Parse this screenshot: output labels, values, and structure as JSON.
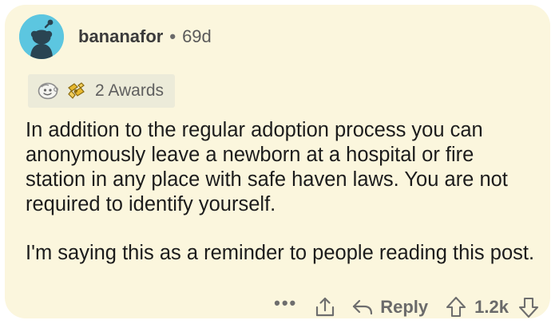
{
  "comment": {
    "username": "bananafor",
    "separator": "•",
    "age": "69d",
    "awards_label": "2 Awards",
    "paragraphs": [
      "In addition to the regular adoption process you can anonymously leave a newborn at a hospital or fire station in any place with safe haven laws. You are not required to identify yourself.",
      "I'm saying this as a reminder to people reading this post."
    ]
  },
  "actions": {
    "more_label": "•••",
    "reply_label": "Reply",
    "score": "1.2k"
  },
  "colors": {
    "card_background": "#fbf6dd",
    "avatar_background": "#5cc6e0",
    "awards_background": "#ecebd9",
    "text": "#1c1c1c",
    "muted": "#6a6a6a"
  },
  "icons": [
    "snoo-avatar",
    "wholesome-award-icon",
    "helpful-award-icon",
    "share-icon",
    "reply-arrow-icon",
    "upvote-icon",
    "downvote-icon"
  ]
}
